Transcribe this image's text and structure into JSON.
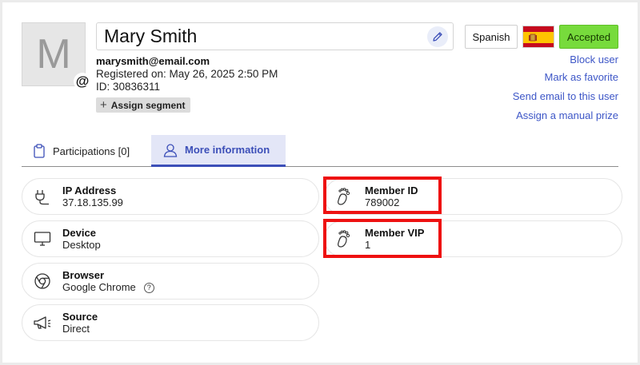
{
  "profile": {
    "avatar_letter": "M",
    "avatar_badge": "@",
    "name": "Mary Smith",
    "email": "marysmith@email.com",
    "registered": "Registered on: May 26, 2025 2:50 PM",
    "id": "ID: 30836311",
    "assign_segment_label": "Assign segment"
  },
  "header_actions": {
    "language": "Spanish",
    "flag": "spain-flag",
    "status": "Accepted",
    "status_color": "#77db3c"
  },
  "links": {
    "block_user": "Block user",
    "mark_favorite": "Mark as favorite",
    "send_email": "Send email to this user",
    "assign_prize": "Assign a manual prize",
    "link_color": "#3d56c7"
  },
  "tabs": [
    {
      "label": "Participations [0]",
      "icon": "clipboard-icon",
      "active": false
    },
    {
      "label": "More information",
      "icon": "user-icon",
      "active": true
    }
  ],
  "info_left": [
    {
      "label": "IP Address",
      "value": "37.18.135.99",
      "icon": "plug-icon"
    },
    {
      "label": "Device",
      "value": "Desktop",
      "icon": "monitor-icon"
    },
    {
      "label": "Browser",
      "value": "Google Chrome",
      "icon": "chrome-icon",
      "help": "?"
    },
    {
      "label": "Source",
      "value": "Direct",
      "icon": "megaphone-icon"
    }
  ],
  "info_right": [
    {
      "label": "Member ID",
      "value": "789002",
      "icon": "footprint-icon"
    },
    {
      "label": "Member VIP",
      "value": "1",
      "icon": "footprint-icon"
    }
  ],
  "colors": {
    "accent": "#3c4fb8",
    "highlight": "#ee1111"
  }
}
